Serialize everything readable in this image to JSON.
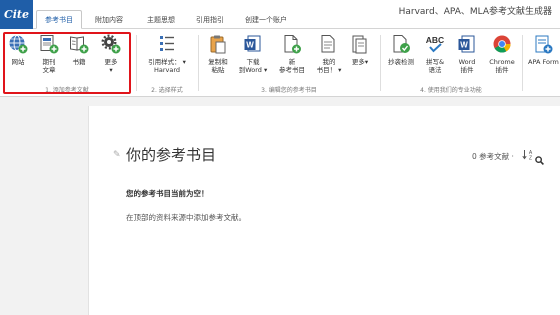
{
  "app": {
    "logo": "Cite",
    "title": "Harvard、APA、MLA参考文献生成器"
  },
  "tabs": [
    {
      "label": "参考书目"
    },
    {
      "label": "附加内容"
    },
    {
      "label": "主题思想"
    },
    {
      "label": "引用指引"
    },
    {
      "label": "创建一个账户"
    }
  ],
  "ribbon": {
    "add_group": {
      "label": "1. 添加参考文献",
      "buttons": [
        {
          "label": "网站",
          "icon": "globe-add-icon"
        },
        {
          "label": "期刊\n文章",
          "icon": "journal-add-icon"
        },
        {
          "label": "书籍",
          "icon": "book-add-icon"
        },
        {
          "label": "更多\n▾",
          "icon": "gears-icon"
        }
      ]
    },
    "style_group": {
      "label": "2. 选择样式",
      "button": {
        "label": "引用样式： ▾\nHarvard",
        "icon": "style-list-icon"
      }
    },
    "edit_group": {
      "label": "3. 编辑您的参考书目",
      "buttons": [
        {
          "label": "复制和\n粘贴",
          "icon": "clipboard-icon"
        },
        {
          "label": "下载\n到Word ▾",
          "icon": "word-download-icon"
        },
        {
          "label": "新\n参考书目",
          "icon": "new-bibliography-icon"
        },
        {
          "label": "我的\n书目！ ▾",
          "icon": "my-bibliography-icon"
        },
        {
          "label": "更多▾",
          "icon": "more-icon"
        }
      ]
    },
    "tools_group": {
      "label": "4. 使用我们的专业功能",
      "buttons": [
        {
          "label": "抄袭检测",
          "icon": "plagiarism-check-icon"
        },
        {
          "label": "拼写&\n语法",
          "icon": "abc-check-icon"
        },
        {
          "label": "Word\n插件",
          "icon": "word-plugin-icon"
        },
        {
          "label": "Chrome\n插件",
          "icon": "chrome-icon"
        }
      ]
    },
    "apa_button": {
      "label": "APA Form",
      "icon": "apa-format-icon"
    }
  },
  "document": {
    "title": "你的参考书目",
    "ref_count": "0 参考文献 ·",
    "sort_glyph": "↓A Z",
    "empty_title": "您的参考书目当前为空！",
    "empty_hint": "在顶部的资料来源中添加参考文献。"
  },
  "colors": {
    "accent": "#1f5ea8",
    "highlight": "#e0141a",
    "add_green": "#3fa14a"
  }
}
